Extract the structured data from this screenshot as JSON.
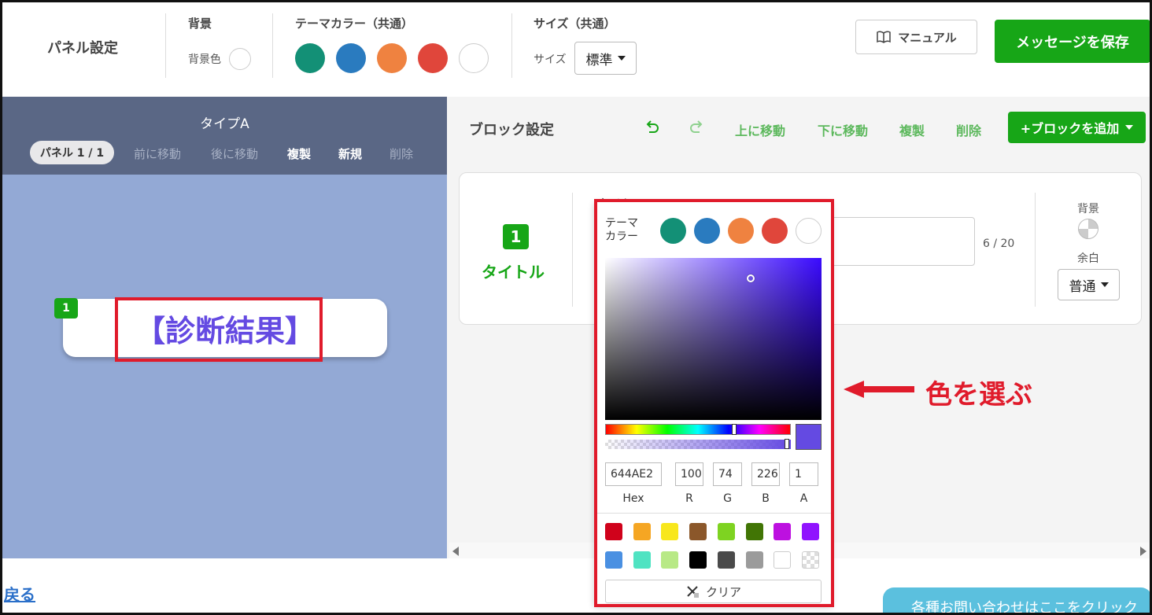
{
  "topbar": {
    "title": "パネル設定",
    "background_group": {
      "label": "背景",
      "color_label": "背景色"
    },
    "theme_group": {
      "label": "テーマカラー（共通）"
    },
    "size_group": {
      "label": "サイズ（共通）",
      "size_label": "サイズ",
      "size_value": "標準"
    },
    "manual_label": "マニュアル",
    "save_label": "メッセージを保存"
  },
  "theme_colors": [
    "#139076",
    "#2a7bbf",
    "#ef8240",
    "#e0463b",
    "#ffffff"
  ],
  "left_panel": {
    "type_title": "タイプA",
    "panel_indicator": "パネル 1 / 1",
    "nav": {
      "prev": "前に移動",
      "next": "後に移動",
      "duplicate": "複製",
      "new": "新規",
      "delete": "削除"
    },
    "block_number": "1",
    "block_text": "【診断結果】",
    "block_text_color": "#644AE2"
  },
  "block_settings": {
    "title": "ブロック設定",
    "undo_icon": "undo-icon",
    "redo_icon": "redo-icon",
    "move_up": "上に移動",
    "move_down": "下に移動",
    "duplicate": "複製",
    "delete": "削除",
    "add_block": "+ブロックを追加"
  },
  "block": {
    "number": "1",
    "label": "タイトル",
    "field_label": "タイトル",
    "counter": "6 / 20",
    "bg_label": "背景",
    "margin_label": "余白",
    "margin_value": "普通"
  },
  "color_picker": {
    "theme_label_line1": "テーマ",
    "theme_label_line2": "カラー",
    "hex": "644AE2",
    "r": "100",
    "g": "74",
    "b": "226",
    "a": "1",
    "labels": {
      "hex": "Hex",
      "r": "R",
      "g": "G",
      "b": "B",
      "a": "A"
    },
    "preset_colors": [
      "#d0021b",
      "#f5a623",
      "#f8e71c",
      "#8b572a",
      "#7ed321",
      "#417505",
      "#bd10e0",
      "#9013fe",
      "#4a90e2",
      "#50e3c2",
      "#b8e986",
      "#000000",
      "#4a4a4a",
      "#9b9b9b",
      "#ffffff",
      "transparent"
    ],
    "clear_label": "クリア"
  },
  "annotation": "色を選ぶ",
  "back_link": "戻る",
  "help_text": "各種お問い合わせはここをクリック"
}
